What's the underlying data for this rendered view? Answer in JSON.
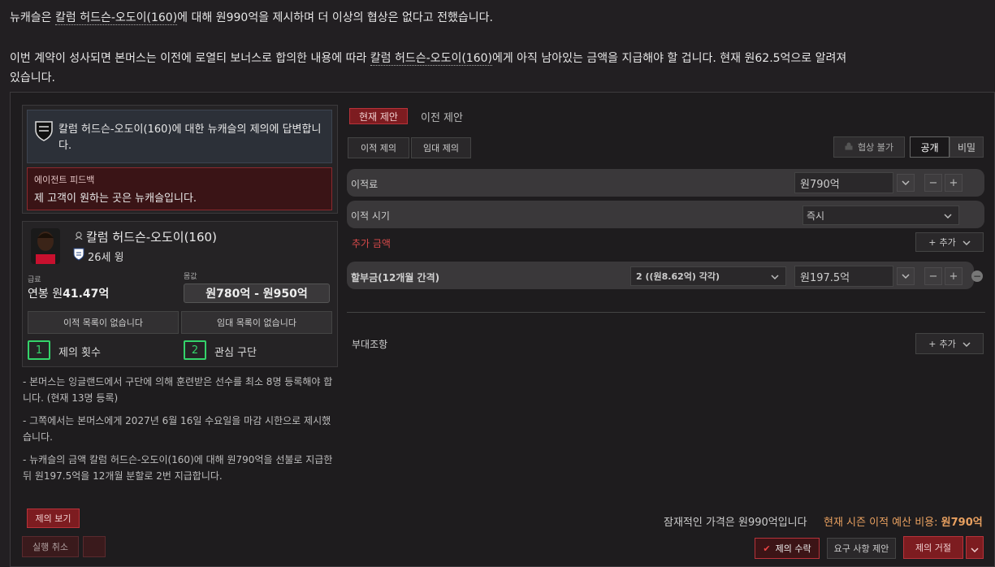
{
  "messages": {
    "line1_pre": "뉴캐슬은 ",
    "line1_player": "칼럼 허드슨-오도이(160)",
    "line1_post": "에 대해 원990억을 제시하며 더 이상의 협상은 없다고 전했습니다.",
    "line2_pre": "이번 계약이 성사되면 본머스는 이전에 로열티 보너스로 합의한 내용에 따라 ",
    "line2_player": "칼럼 허드슨-오도이(160)",
    "line2_post": "에게 아직 남아있는 금액을 지급해야 할 겁니다. 현재 원62.5억으로 알려져",
    "line3": "있습니다."
  },
  "left": {
    "club_prompt": "칼럼 허드슨-오도이(160)에 대한 뉴캐슬의 제의에 답변합니다.",
    "agent_feedback_title": "에이전트 피드백",
    "agent_feedback_text": "제 고객이 원하는 곳은 뉴캐슬입니다.",
    "player_name": "칼럼 허드슨-오도이(160)",
    "player_info": "26세 윙",
    "wage_label": "급료",
    "wage_prefix": "연봉 원",
    "wage_value": "41.47억",
    "value_label": "몸값",
    "value_text": "원780억 - 원950억",
    "transfer_list_btn": "이적 목록이 없습니다",
    "loan_list_btn": "임대 목록이 없습니다",
    "offers_count": "1",
    "offers_label": "제의 횟수",
    "interest_count": "2",
    "interest_label": "관심 구단",
    "notes": [
      "- 본머스는 잉글랜드에서 구단에 의해 훈련받은 선수를 최소 8명 등록해야 합니다. (현재 13명 등록)",
      "- 그쪽에서는 본머스에게 2027년 6월 16일 수요일을 마감 시한으로 제시했습니다.",
      "- 뉴캐슬의 금액 칼럼 허드슨-오도이(160)에 대해 원790억을 선불로 지급한 뒤 원197.5억을 12개월 분할로 2번 지급합니다."
    ],
    "view_offer_btn": "제의 보기",
    "undo_btn": "실행 취소"
  },
  "right": {
    "tab_current": "현재 제안",
    "tab_previous": "이전 제안",
    "subtab_transfer": "이적 제의",
    "subtab_loan": "임대 제의",
    "non_negotiable": "협상 불가",
    "public": "공개",
    "private": "비밀",
    "fee_label": "이적료",
    "fee_value": "원790억",
    "timing_label": "이적 시기",
    "timing_value": "즉시",
    "extra_label": "추가 금액",
    "add_label": "추가",
    "installments_label": "할부금(12개월 간격)",
    "installments_count": "2 ((원8.62억) 각각)",
    "installments_value": "원197.5억",
    "clauses_label": "부대조항",
    "valuation_text": "잠재적인 가격은 원990억입니다",
    "budget_label": "현재 시즌 이적 예산 비용:",
    "budget_value": "원790억",
    "accept_btn": "제의 수락",
    "demand_btn": "요구 사항 제안",
    "reject_btn": "제의 거절"
  },
  "colors": {
    "accent_red": "#b8323a",
    "green": "#34d36a",
    "orange": "#e8a060"
  }
}
